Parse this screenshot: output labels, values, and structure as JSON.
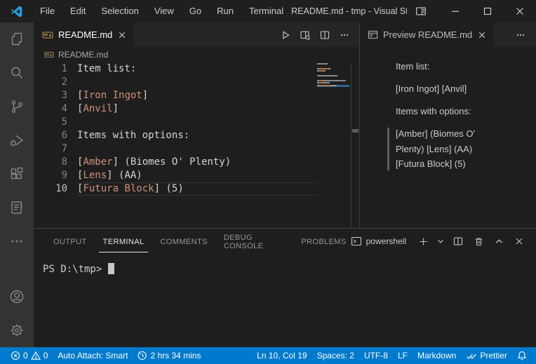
{
  "titlebar": {
    "menus": [
      "File",
      "Edit",
      "Selection",
      "View",
      "Go",
      "Run",
      "Terminal"
    ],
    "title": "README.md - tmp - Visual Studi...",
    "window_icons": [
      "layout-icon",
      "minimize-icon",
      "maximize-icon",
      "close-icon"
    ]
  },
  "activity_bar": {
    "icons": [
      "explorer-icon",
      "search-icon",
      "source-control-icon",
      "run-debug-icon",
      "extensions-icon",
      "notebook-icon",
      "more-icon",
      "account-icon",
      "settings-gear-icon"
    ]
  },
  "editor": {
    "tab": {
      "icon": "markdown-icon",
      "label": "README.md"
    },
    "actions": [
      "run-icon",
      "open-preview-side-icon",
      "split-editor-icon",
      "more-actions-icon"
    ],
    "breadcrumb": {
      "icon": "markdown-icon",
      "label": "README.md"
    },
    "cursor_line": 10,
    "lines": [
      {
        "n": "1",
        "parts": [
          {
            "t": "plain",
            "s": "Item list:"
          }
        ]
      },
      {
        "n": "2",
        "parts": []
      },
      {
        "n": "3",
        "parts": [
          {
            "t": "punct",
            "s": "["
          },
          {
            "t": "link",
            "s": "Iron Ingot"
          },
          {
            "t": "punct",
            "s": "]"
          }
        ]
      },
      {
        "n": "4",
        "parts": [
          {
            "t": "punct",
            "s": "["
          },
          {
            "t": "link",
            "s": "Anvil"
          },
          {
            "t": "punct",
            "s": "]"
          }
        ]
      },
      {
        "n": "5",
        "parts": []
      },
      {
        "n": "6",
        "parts": [
          {
            "t": "plain",
            "s": "Items with options:"
          }
        ]
      },
      {
        "n": "7",
        "parts": []
      },
      {
        "n": "8",
        "parts": [
          {
            "t": "punct",
            "s": "["
          },
          {
            "t": "link",
            "s": "Amber"
          },
          {
            "t": "punct",
            "s": "]"
          },
          {
            "t": "plain",
            "s": " (Biomes O' Plenty)"
          }
        ]
      },
      {
        "n": "9",
        "parts": [
          {
            "t": "punct",
            "s": "["
          },
          {
            "t": "link",
            "s": "Lens"
          },
          {
            "t": "punct",
            "s": "]"
          },
          {
            "t": "plain",
            "s": " (AA)"
          }
        ]
      },
      {
        "n": "10",
        "current": true,
        "parts": [
          {
            "t": "punct",
            "s": "["
          },
          {
            "t": "link",
            "s": "Futura Block"
          },
          {
            "t": "punct",
            "s": "]"
          },
          {
            "t": "plain",
            "s": " (5)"
          }
        ]
      }
    ]
  },
  "preview": {
    "tab": {
      "icon": "preview-icon",
      "label": "Preview README.md"
    },
    "paragraphs": [
      {
        "text": "Item list:",
        "active": false
      },
      {
        "text": "[Iron Ingot] [Anvil]",
        "active": false
      },
      {
        "text": "Items with options:",
        "active": false
      },
      {
        "text": "[Amber] (Biomes O' Plenty) [Lens] (AA) [Futura Block] (5)",
        "active": true
      }
    ]
  },
  "panel": {
    "tabs": [
      {
        "label": "OUTPUT",
        "active": false
      },
      {
        "label": "TERMINAL",
        "active": true
      },
      {
        "label": "COMMENTS",
        "active": false
      },
      {
        "label": "DEBUG CONSOLE",
        "active": false
      },
      {
        "label": "PROBLEMS",
        "active": false
      }
    ],
    "shell": {
      "icon": "terminal-icon",
      "label": "powershell"
    },
    "actions": [
      "new-terminal-icon",
      "chevron-down-icon",
      "split-terminal-icon",
      "kill-terminal-icon",
      "maximize-panel-icon",
      "close-panel-icon"
    ],
    "terminal": {
      "prompt": "PS D:\\tmp>",
      "cursor": "block"
    }
  },
  "statusbar": {
    "left": [
      {
        "name": "problems",
        "error_count": "0",
        "warning_count": "0",
        "icons": [
          "error-icon",
          "warning-icon"
        ]
      },
      {
        "name": "auto-attach",
        "label": "Auto Attach: Smart"
      },
      {
        "name": "session-time",
        "icon": "history-icon",
        "label": "2 hrs 34 mins"
      }
    ],
    "right": [
      {
        "name": "cursor-position",
        "label": "Ln 10, Col 19"
      },
      {
        "name": "indentation",
        "label": "Spaces: 2"
      },
      {
        "name": "encoding",
        "label": "UTF-8"
      },
      {
        "name": "eol",
        "label": "LF"
      },
      {
        "name": "language",
        "label": "Markdown"
      },
      {
        "name": "formatter",
        "icon": "double-check-icon",
        "label": "Prettier"
      },
      {
        "name": "notifications",
        "icon": "bell-icon"
      }
    ]
  },
  "colors": {
    "statusbar": "#007acc",
    "editor_bg": "#1e1e1e",
    "activity_bar_bg": "#333333",
    "tabstrip_bg": "#252526",
    "titlebar_bg": "#1f1f20",
    "link_text": "#ce9178",
    "plain_text": "#d4d4d4",
    "line_number": "#858585",
    "markdown_icon": "#c09553",
    "minimap_highlight": "#2e6296"
  }
}
